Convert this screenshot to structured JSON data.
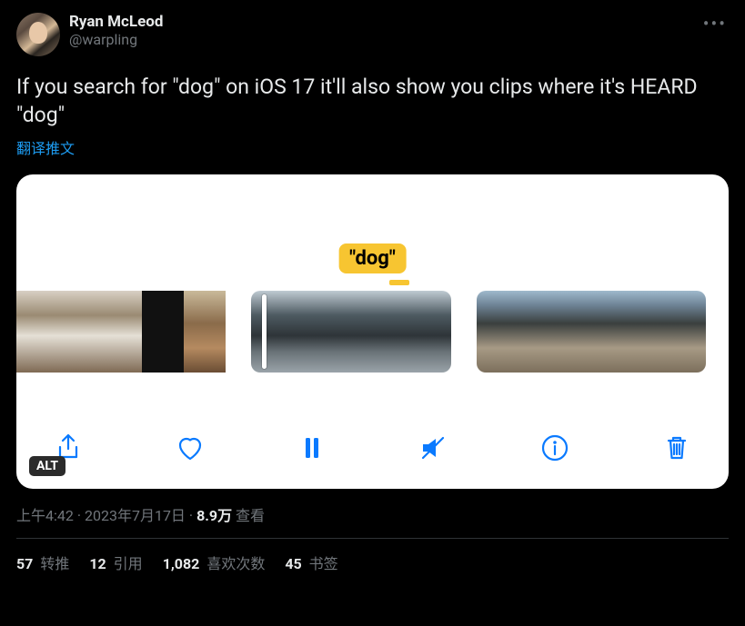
{
  "user": {
    "display_name": "Ryan McLeod",
    "handle": "@warpling"
  },
  "tweet_text": "If you search for \"dog\" on iOS 17 it'll also show you clips where it's HEARD \"dog\"",
  "translate_label": "翻译推文",
  "media": {
    "tag_label": "\"dog\"",
    "alt_badge": "ALT"
  },
  "meta": {
    "time": "上午4:42",
    "date": "2023年7月17日",
    "separator": " · ",
    "views_count": "8.9万",
    "views_label": " 查看"
  },
  "stats": {
    "retweets": {
      "count": "57",
      "label": " 转推"
    },
    "quotes": {
      "count": "12",
      "label": " 引用"
    },
    "likes": {
      "count": "1,082",
      "label": " 喜欢次数"
    },
    "bookmarks": {
      "count": "45",
      "label": " 书签"
    }
  }
}
